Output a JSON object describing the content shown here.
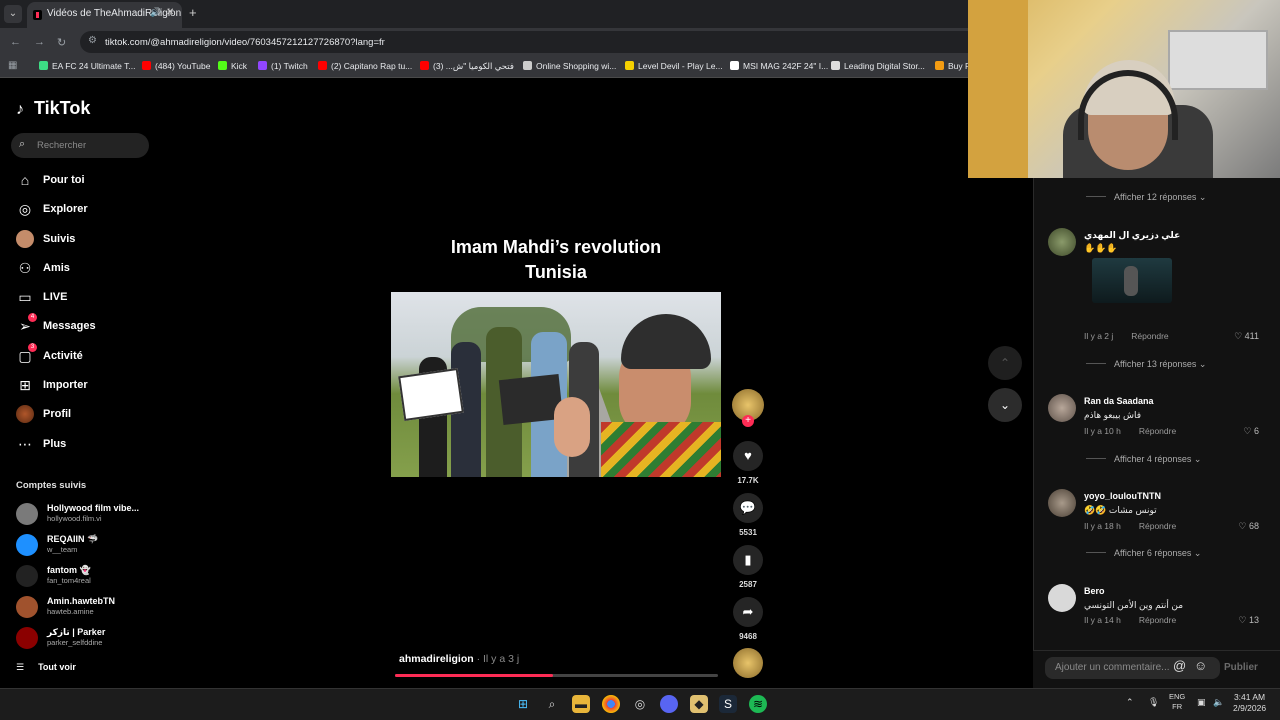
{
  "browser": {
    "tab_title": "Vidéos de TheAhmadiReligion",
    "url": "tiktok.com/@ahmadireligion/video/7603457212127726870?lang=fr",
    "bookmarks": [
      {
        "label": "EA FC 24 Ultimate T...",
        "color": "#3ddc84"
      },
      {
        "label": "(484) YouTube",
        "color": "#ff0000"
      },
      {
        "label": "Kick",
        "color": "#53fc18"
      },
      {
        "label": "(1) Twitch",
        "color": "#9146ff"
      },
      {
        "label": "(2) Capitano Rap tu...",
        "color": "#ff0000"
      },
      {
        "label": "فتحي الكوميا \"ش... (3)",
        "color": "#ff0000"
      },
      {
        "label": "Online Shopping wi...",
        "color": "#cccccc"
      },
      {
        "label": "Level Devil - Play Le...",
        "color": "#f5d000"
      },
      {
        "label": "MSI MAG 242F 24\" I...",
        "color": "#ffffff"
      },
      {
        "label": "Leading Digital Stor...",
        "color": "#dddddd"
      },
      {
        "label": "Buy P",
        "color": "#f39c12"
      }
    ]
  },
  "tiktok": {
    "logo": "TikTok",
    "search_placeholder": "Rechercher",
    "nav": [
      {
        "label": "Pour toi",
        "icon": "home-icon",
        "glyph": "⌂"
      },
      {
        "label": "Explorer",
        "icon": "compass-icon",
        "glyph": "◎"
      },
      {
        "label": "Suivis",
        "icon": "avatar-icon",
        "glyph": "●"
      },
      {
        "label": "Amis",
        "icon": "friends-icon",
        "glyph": "⚇"
      },
      {
        "label": "LIVE",
        "icon": "live-icon",
        "glyph": "▭"
      },
      {
        "label": "Messages",
        "icon": "send-icon",
        "glyph": "➢",
        "badge": "4"
      },
      {
        "label": "Activité",
        "icon": "inbox-icon",
        "glyph": "▢",
        "badge": "3"
      },
      {
        "label": "Importer",
        "icon": "upload-icon",
        "glyph": "⊞"
      },
      {
        "label": "Profil",
        "icon": "profile-icon",
        "glyph": "●"
      },
      {
        "label": "Plus",
        "icon": "more-icon",
        "glyph": "⋯"
      }
    ],
    "followed_header": "Comptes suivis",
    "followed": [
      {
        "name": "Hollywood film vibe...",
        "handle": "hollywood.film.vi",
        "color": "#7a7a7a"
      },
      {
        "name": "REQAIIN 🦈",
        "handle": "w__team",
        "color": "#1e90ff"
      },
      {
        "name": "fantom 👻",
        "handle": "fan_tom4real",
        "color": "#222222"
      },
      {
        "name": "Amin.hawtebTN",
        "handle": "hawteb.amine",
        "color": "#a0522d"
      },
      {
        "name": "تازكر | Parker",
        "handle": "parker_selfddine",
        "color": "#8b0000"
      }
    ],
    "see_all": "Tout voir"
  },
  "video": {
    "title_line1": "Imam Mahdi’s revolution",
    "title_line2": "Tunisia",
    "author": "ahmadireligion",
    "time": " · Il y a 3 j",
    "likes": "17.7K",
    "comments": "5531",
    "saves": "2587",
    "shares": "9468",
    "progress": 0.49
  },
  "comments": {
    "show_12": "Afficher 12 réponses ⌄",
    "c1_user": "علي دزيري ال المهدي",
    "c1_text": "✋✋✋",
    "c1_meta": "Il y a 2 j",
    "c1_likes": "♡ 411",
    "show_13": "Afficher 13 réponses ⌄",
    "c2_user": "Ran da Saadana",
    "c2_text": "فاش بيبعو هاذم",
    "c2_meta": "Il y a 10 h",
    "c2_likes": "♡ 6",
    "show_4": "Afficher 4 réponses ⌄",
    "c3_user": "yoyo_loulouTNTN",
    "c3_text": "🤣🤣 تونس مشات",
    "c3_meta": "Il y a 18 h",
    "c3_likes": "♡ 68",
    "show_6": "Afficher 6 réponses ⌄",
    "c4_user": "Bero",
    "c4_text": "من أنتم وين الأمن التونسي",
    "c4_meta": "Il y a 14 h",
    "c4_likes": "♡ 13",
    "reply": "Répondre",
    "input_placeholder": "Ajouter un commentaire...",
    "publish": "Publier"
  },
  "taskbar": {
    "lang_1": "ENG",
    "lang_2": "FR",
    "time": "3:41 AM",
    "date": "2/9/2026"
  }
}
